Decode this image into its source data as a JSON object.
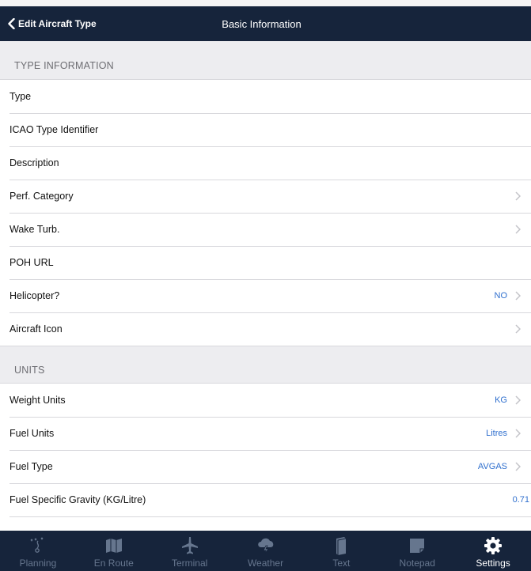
{
  "nav": {
    "back_label": "Edit Aircraft Type",
    "title": "Basic Information"
  },
  "type_info": {
    "header": "TYPE INFORMATION",
    "rows": [
      {
        "label": "Type",
        "value": "",
        "chevron": false
      },
      {
        "label": "ICAO Type Identifier",
        "value": "",
        "chevron": false
      },
      {
        "label": "Description",
        "value": "",
        "chevron": false
      },
      {
        "label": "Perf. Category",
        "value": "",
        "chevron": true
      },
      {
        "label": "Wake Turb.",
        "value": "",
        "chevron": true
      },
      {
        "label": "POH URL",
        "value": "",
        "chevron": false
      },
      {
        "label": "Helicopter?",
        "value": "NO",
        "chevron": true
      },
      {
        "label": "Aircraft Icon",
        "value": "",
        "chevron": true
      }
    ]
  },
  "units": {
    "header": "UNITS",
    "rows": [
      {
        "label": "Weight Units",
        "value": "KG",
        "chevron": true
      },
      {
        "label": "Fuel Units",
        "value": "Litres",
        "chevron": true
      },
      {
        "label": "Fuel Type",
        "value": "AVGAS",
        "chevron": true
      },
      {
        "label": "Fuel Specific Gravity (KG/Litre)",
        "value": "0.71",
        "chevron": false
      }
    ]
  },
  "tabs": [
    {
      "label": "Planning",
      "icon": "planning-icon",
      "active": false
    },
    {
      "label": "En Route",
      "icon": "map-icon",
      "active": false
    },
    {
      "label": "Terminal",
      "icon": "airplane-icon",
      "active": false
    },
    {
      "label": "Weather",
      "icon": "weather-icon",
      "active": false
    },
    {
      "label": "Text",
      "icon": "text-icon",
      "active": false
    },
    {
      "label": "Notepad",
      "icon": "notepad-icon",
      "active": false
    },
    {
      "label": "Settings",
      "icon": "gear-icon",
      "active": true
    }
  ],
  "colors": {
    "navbar": "#16243b",
    "accent": "#2f6fce",
    "background": "#ededf0"
  }
}
